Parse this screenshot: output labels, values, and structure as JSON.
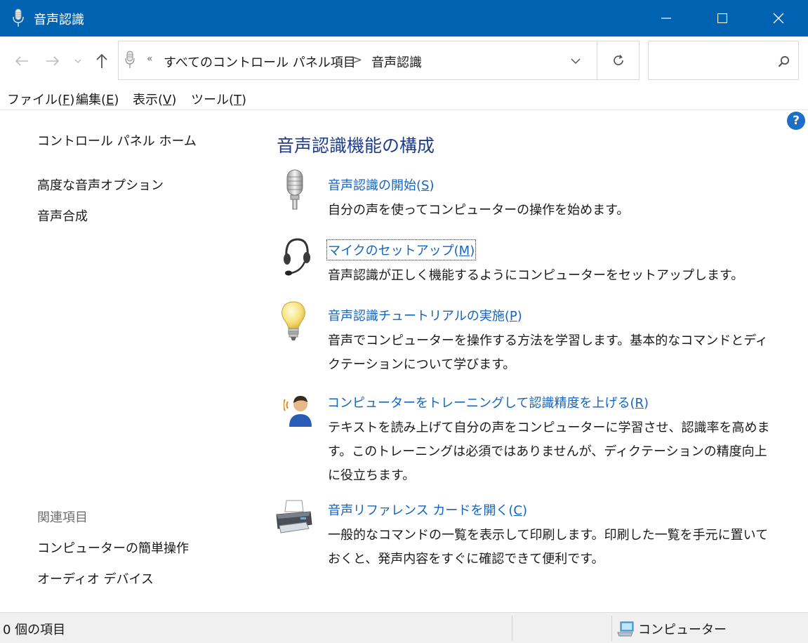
{
  "window": {
    "title": "音声認識",
    "colors": {
      "titlebar": "#0063b1",
      "link": "#1464c0",
      "heading": "#1e3d8c"
    }
  },
  "address": {
    "overflow_marker": "«",
    "crumbs": [
      "すべてのコントロール パネル項目",
      "音声認識"
    ],
    "separator": ">",
    "search_placeholder": ""
  },
  "menu": {
    "items": [
      {
        "label": "ファイル(",
        "key": "F",
        "close": ")"
      },
      {
        "label": "編集(",
        "key": "E",
        "close": ")"
      },
      {
        "label": "表示(",
        "key": "V",
        "close": ")"
      },
      {
        "label": "ツール(",
        "key": "T",
        "close": ")"
      }
    ]
  },
  "sidebar": {
    "home": "コントロール パネル ホーム",
    "links": [
      "高度な音声オプション",
      "音声合成"
    ],
    "related_heading": "関連項目",
    "related": [
      "コンピューターの簡単操作",
      "オーディオ デバイス"
    ]
  },
  "main": {
    "help_glyph": "?",
    "title": "音声認識機能の構成",
    "tasks": [
      {
        "icon": "microphone-icon",
        "link": "音声認識の開始(",
        "key": "S",
        "close": ")",
        "desc": "自分の声を使ってコンピューターの操作を始めます。"
      },
      {
        "icon": "headset-icon",
        "link": "マイクのセットアップ(",
        "key": "M",
        "close": ")",
        "desc": "音声認識が正しく機能するようにコンピューターをセットアップします。"
      },
      {
        "icon": "lightbulb-icon",
        "link": "音声認識チュートリアルの実施(",
        "key": "P",
        "close": ")",
        "desc": "音声でコンピューターを操作する方法を学習します。基本的なコマンドとディクテーションについて学びます。"
      },
      {
        "icon": "user-speaking-icon",
        "link": "コンピューターをトレーニングして認識精度を上げる(",
        "key": "R",
        "close": ")",
        "desc": "テキストを読み上げて自分の声をコンピューターに学習させ、認識率を高めます。このトレーニングは必須ではありませんが、ディクテーションの精度向上に役立ちます。"
      },
      {
        "icon": "printer-icon",
        "link": "音声リファレンス カードを開く(",
        "key": "C",
        "close": ")",
        "desc": "一般的なコマンドの一覧を表示して印刷します。印刷した一覧を手元に置いておくと、発声内容をすぐに確認できて便利です。"
      }
    ]
  },
  "status": {
    "items_count": "0 個の項目",
    "location": "コンピューター"
  }
}
